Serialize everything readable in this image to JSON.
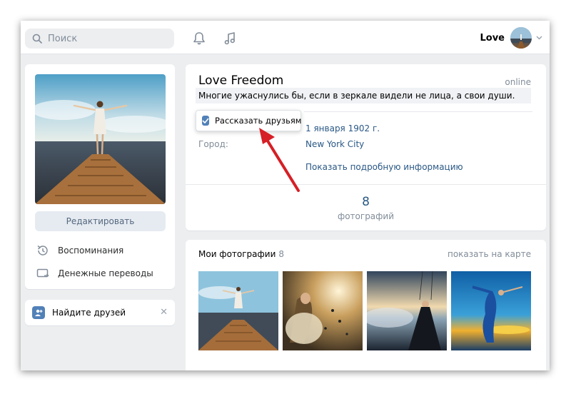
{
  "header": {
    "search_placeholder": "Поиск",
    "user_name": "Love",
    "icons": [
      "search-icon",
      "bell-icon",
      "music-icon",
      "chevron-down-icon"
    ]
  },
  "left": {
    "edit_label": "Редактировать",
    "menu": [
      {
        "label": "Воспоминания",
        "icon": "history-icon"
      },
      {
        "label": "Денежные переводы",
        "icon": "money-transfer-icon"
      }
    ],
    "friends_label": "Найдите друзей",
    "friends_close": "✕"
  },
  "profile": {
    "name": "Love Freedom",
    "online": "online",
    "status": "Многие ужаснулись бы, если в зеркале видели не лица, а свои души.",
    "tell_friends_label": "Рассказать друзьям",
    "tell_friends_checked": true,
    "birthday_value": "1 января 1902 г.",
    "city_label": "Город:",
    "city_value": "New York City",
    "more_info": "Показать подробную информацию",
    "photos_count": "8",
    "photos_label": "фотографий"
  },
  "photos": {
    "title": "Мои фотографии",
    "count": "8",
    "map_link": "показать на карте"
  },
  "colors": {
    "accent": "#5181b8",
    "link": "#2a5885",
    "muted": "#818c99",
    "background": "#edeef0",
    "annotation_arrow": "#d61f26"
  }
}
